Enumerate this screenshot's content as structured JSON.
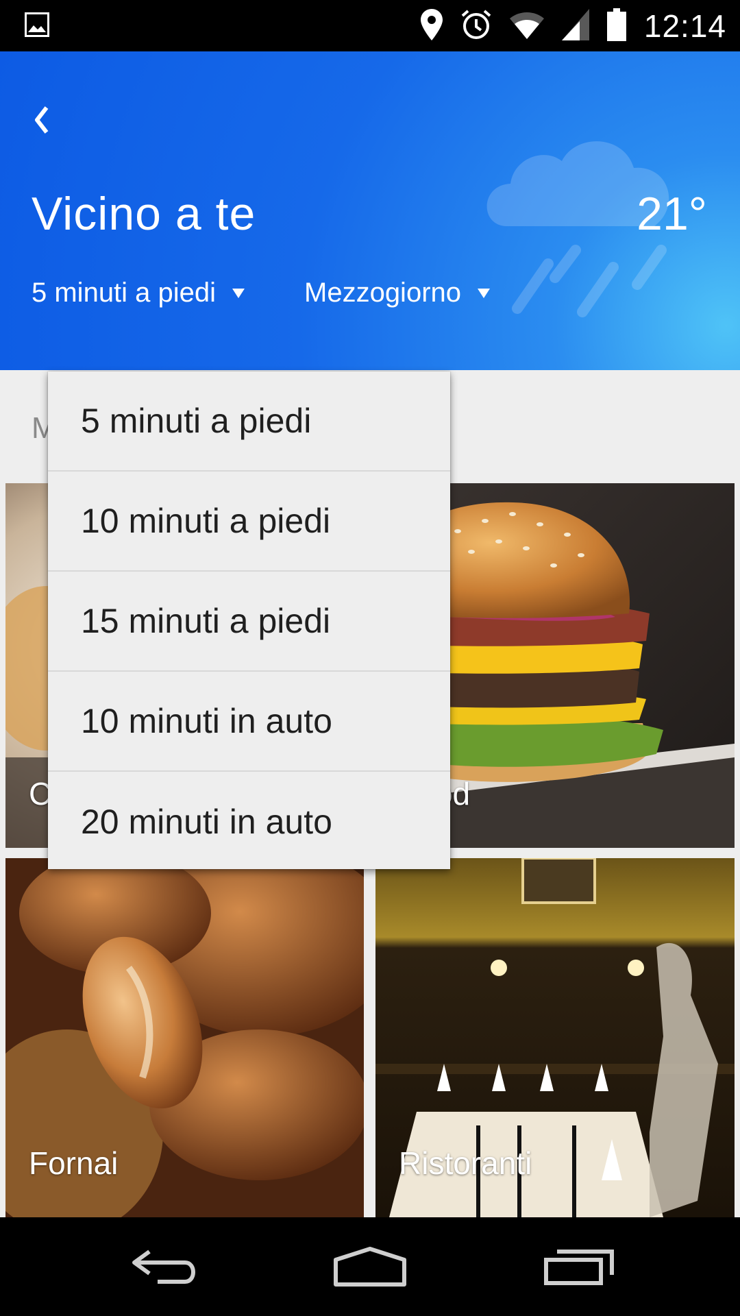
{
  "status_bar": {
    "time": "12:14",
    "icons": [
      "image-notification-icon",
      "location-icon",
      "alarm-icon",
      "wifi-icon",
      "cell-signal-icon",
      "battery-icon"
    ]
  },
  "header": {
    "title": "Vicino a te",
    "temperature": "21°",
    "weather_icon": "rain-cloud-icon",
    "filters": {
      "distance": "5 minuti a piedi",
      "time_of_day": "Mezzogiorno"
    }
  },
  "content": {
    "section_label_partial": "M",
    "tiles": [
      {
        "label_partial": "C",
        "image": "food-plate-photo"
      },
      {
        "label_partial": "st food",
        "image": "burger-photo"
      },
      {
        "label": "Fornai",
        "image": "bread-photo"
      },
      {
        "label": "Ristoranti",
        "image": "restaurant-interior-photo"
      }
    ]
  },
  "dropdown": {
    "options": [
      "5 minuti a piedi",
      "10 minuti a piedi",
      "15 minuti a piedi",
      "10 minuti in auto",
      "20 minuti in auto"
    ]
  },
  "colors": {
    "header_blue": "#1669e9",
    "header_light_blue": "#4fc3f7",
    "menu_background": "#eeeeee",
    "content_background": "#eeeeee"
  }
}
